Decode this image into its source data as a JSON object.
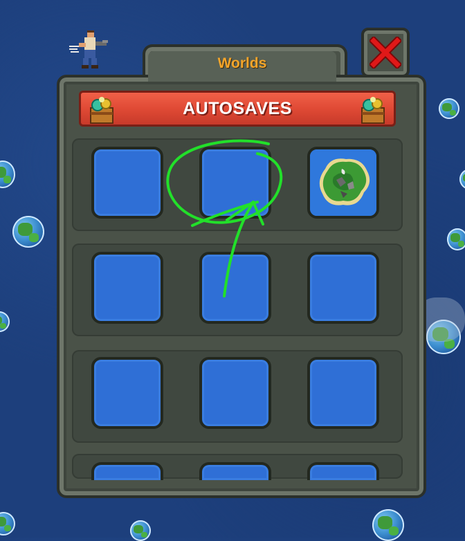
{
  "window": {
    "title": "Worlds",
    "close_icon": "close-x-icon",
    "close_color": "#e01818"
  },
  "banner": {
    "label": "AUTOSAVES",
    "icon": "treasure-chest-icon",
    "color": "#e04a35"
  },
  "slots": [
    {
      "row": 1,
      "col": 1,
      "state": "empty"
    },
    {
      "row": 1,
      "col": 2,
      "state": "empty"
    },
    {
      "row": 1,
      "col": 3,
      "state": "saved-world"
    },
    {
      "row": 2,
      "col": 1,
      "state": "empty"
    },
    {
      "row": 2,
      "col": 2,
      "state": "empty"
    },
    {
      "row": 2,
      "col": 3,
      "state": "empty"
    },
    {
      "row": 3,
      "col": 1,
      "state": "empty"
    },
    {
      "row": 3,
      "col": 2,
      "state": "empty"
    },
    {
      "row": 3,
      "col": 3,
      "state": "empty"
    },
    {
      "row": 4,
      "col": 1,
      "state": "empty"
    },
    {
      "row": 4,
      "col": 2,
      "state": "empty"
    },
    {
      "row": 4,
      "col": 3,
      "state": "empty"
    }
  ],
  "colors": {
    "title_text": "#f4a52a",
    "slot_fill": "#2f6fd6",
    "annotation": "#22e02a",
    "background": "#1d3f7c"
  },
  "decorations": {
    "character_icon": "pixel-character-running-icon",
    "planet_icon": "planet-globe-icon",
    "annotation": "hand-drawn-green-circle-and-arrow"
  }
}
